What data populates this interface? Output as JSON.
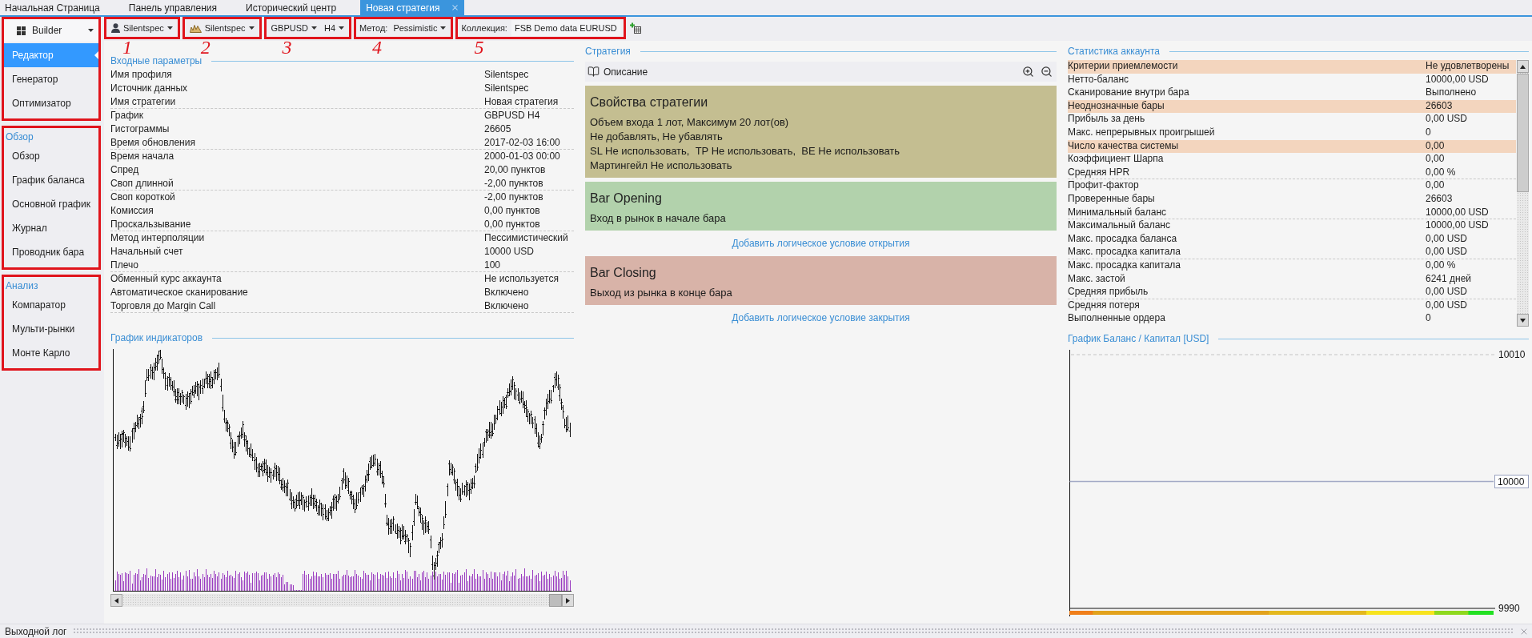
{
  "tabs": [
    {
      "label": "Начальная Страница",
      "selected": false
    },
    {
      "label": "Панель управления",
      "selected": false
    },
    {
      "label": "Исторический центр",
      "selected": false
    },
    {
      "label": "Новая стратегия",
      "selected": true
    }
  ],
  "sidebar": {
    "sections": [
      {
        "framed": true,
        "mode_dropdown": "Builder",
        "items": [
          {
            "label": "Редактор",
            "selected": true
          },
          {
            "label": "Генератор",
            "selected": false
          },
          {
            "label": "Оптимизатор",
            "selected": false
          }
        ]
      },
      {
        "framed": true,
        "title": "Обзор",
        "items": [
          {
            "label": "Обзор",
            "selected": false
          },
          {
            "label": "График баланса",
            "selected": false
          },
          {
            "label": "Основной график",
            "selected": false
          },
          {
            "label": "Журнал",
            "selected": false
          },
          {
            "label": "Проводник бара",
            "selected": false
          }
        ]
      },
      {
        "framed": true,
        "title": "Анализ",
        "items": [
          {
            "label": "Компаратор",
            "selected": false
          },
          {
            "label": "Мульти-рынки",
            "selected": false
          },
          {
            "label": "Монте Карло",
            "selected": false
          }
        ]
      }
    ]
  },
  "toolbar": {
    "groups": [
      {
        "annotation": "1",
        "items": [
          {
            "kind": "profile",
            "value": "Silentspec"
          }
        ]
      },
      {
        "annotation": "2",
        "items": [
          {
            "kind": "source",
            "value": "Silentspec"
          }
        ]
      },
      {
        "annotation": "3",
        "items": [
          {
            "kind": "select",
            "value": "GBPUSD"
          },
          {
            "kind": "select",
            "value": "H4"
          }
        ]
      },
      {
        "annotation": "4",
        "items": [
          {
            "kind": "select",
            "label": "Метод:",
            "value": "Pessimistic"
          }
        ]
      },
      {
        "annotation": "5",
        "items": [
          {
            "kind": "field",
            "label": "Коллекция:",
            "value": "FSB Demo data EURUSD"
          }
        ]
      }
    ]
  },
  "input_params": {
    "title": "Входные параметры",
    "groups": [
      {
        "rows": [
          {
            "name": "Имя профиля",
            "value": "Silentspec"
          },
          {
            "name": "Источник данных",
            "value": "Silentspec"
          },
          {
            "name": "Имя стратегии",
            "value": "Новая стратегия"
          }
        ]
      },
      {
        "rows": [
          {
            "name": "График",
            "value": "GBPUSD H4"
          },
          {
            "name": "Гистограммы",
            "value": "26605"
          },
          {
            "name": "Время обновления",
            "value": "2017-02-03 16:00"
          }
        ]
      },
      {
        "rows": [
          {
            "name": "Время начала",
            "value": "2000-01-03 00:00"
          },
          {
            "name": "Спред",
            "value": "20,00 пунктов"
          },
          {
            "name": "Своп длинной",
            "value": "-2,00 пунктов"
          }
        ]
      },
      {
        "rows": [
          {
            "name": "Своп короткой",
            "value": "-2,00 пунктов"
          },
          {
            "name": "Комиссия",
            "value": "0,00 пунктов"
          },
          {
            "name": "Проскальзывание",
            "value": "0,00 пунктов"
          }
        ]
      },
      {
        "rows": [
          {
            "name": "Метод интерполяции",
            "value": "Пессимистический"
          },
          {
            "name": "Начальный счет",
            "value": "10000 USD"
          },
          {
            "name": "Плечо",
            "value": "100"
          }
        ]
      },
      {
        "rows": [
          {
            "name": "Обменный курс аккаунта",
            "value": "Не используется"
          },
          {
            "name": "Автоматическое сканирование",
            "value": "Включено"
          },
          {
            "name": "Торговля до Margin Call",
            "value": "Включено"
          }
        ]
      }
    ]
  },
  "indicator_chart": {
    "title": "График индикаторов"
  },
  "strategy": {
    "title": "Стратегия",
    "toolbar": {
      "label": "Описание"
    },
    "slots": [
      {
        "kind": "properties",
        "title": "Свойства стратегии",
        "lines": [
          "Объем входа 1 лот, Максимум 20 лот(ов)",
          "Не добавлять, Не убавлять",
          "SL Не использовать,  TP Не использовать,  BE Не использовать",
          "Мартингейл Не использовать"
        ]
      },
      {
        "kind": "opening",
        "title": "Bar Opening",
        "lines": [
          "Вход в рынок в начале бара"
        ],
        "link": "Добавить логическое условие открытия"
      },
      {
        "kind": "closing",
        "title": "Bar Closing",
        "lines": [
          "Выход из рынка в конце бара"
        ],
        "link": "Добавить логическое условие закрытия"
      }
    ]
  },
  "stats": {
    "title": "Статистика аккаунта",
    "groups": [
      {
        "rows": [
          {
            "name": "Критерии приемлемости",
            "value": "Не удовлетворены",
            "highlighted": true
          },
          {
            "name": "Нетто-баланс",
            "value": "10000,00 USD",
            "highlighted": false
          },
          {
            "name": "Сканирование внутри бара",
            "value": "Выполнено",
            "highlighted": false
          }
        ]
      },
      {
        "rows": [
          {
            "name": "Неоднозначные бары",
            "value": "26603",
            "highlighted": true
          },
          {
            "name": "Прибыль за день",
            "value": "0,00 USD",
            "highlighted": false
          },
          {
            "name": "Макс. непрерывных проигрышей",
            "value": "0",
            "highlighted": false
          }
        ]
      },
      {
        "rows": [
          {
            "name": "Число качества системы",
            "value": "0,00",
            "highlighted": true
          },
          {
            "name": "Коэффициент Шарпа",
            "value": "0,00",
            "highlighted": false
          },
          {
            "name": "Средняя HPR",
            "value": "0,00 %",
            "highlighted": false
          }
        ]
      },
      {
        "rows": [
          {
            "name": "Профит-фактор",
            "value": "0,00",
            "highlighted": false
          },
          {
            "name": "Проверенные бары",
            "value": "26603",
            "highlighted": false
          },
          {
            "name": "Минимальный баланс",
            "value": "10000,00 USD",
            "highlighted": false
          }
        ]
      },
      {
        "rows": [
          {
            "name": "Максимальный баланс",
            "value": "10000,00 USD",
            "highlighted": false
          },
          {
            "name": "Макс. просадка баланса",
            "value": "0,00 USD",
            "highlighted": false
          },
          {
            "name": "Макс. просадка капитала",
            "value": "0,00 USD",
            "highlighted": false
          }
        ]
      },
      {
        "rows": [
          {
            "name": "Макс. просадка капитала",
            "value": "0,00 %",
            "highlighted": false
          },
          {
            "name": "Макс. застой",
            "value": "6241 дней",
            "highlighted": false
          },
          {
            "name": "Средняя прибыль",
            "value": "0,00 USD",
            "highlighted": false
          }
        ]
      },
      {
        "rows": [
          {
            "name": "Средняя потеря",
            "value": "0,00 USD",
            "highlighted": false
          },
          {
            "name": "Выполненные ордера",
            "value": "0",
            "highlighted": false
          }
        ]
      }
    ]
  },
  "balance_chart": {
    "chart_data": {
      "type": "line",
      "title": "График Баланс / Капитал [USD]",
      "categories": [
        null,
        null
      ],
      "values": [
        10000,
        10000
      ],
      "ylim": [
        9990,
        10010
      ],
      "yticks": [
        9990,
        10000,
        10010
      ]
    }
  },
  "output_log": {
    "title": "Выходной лог"
  }
}
